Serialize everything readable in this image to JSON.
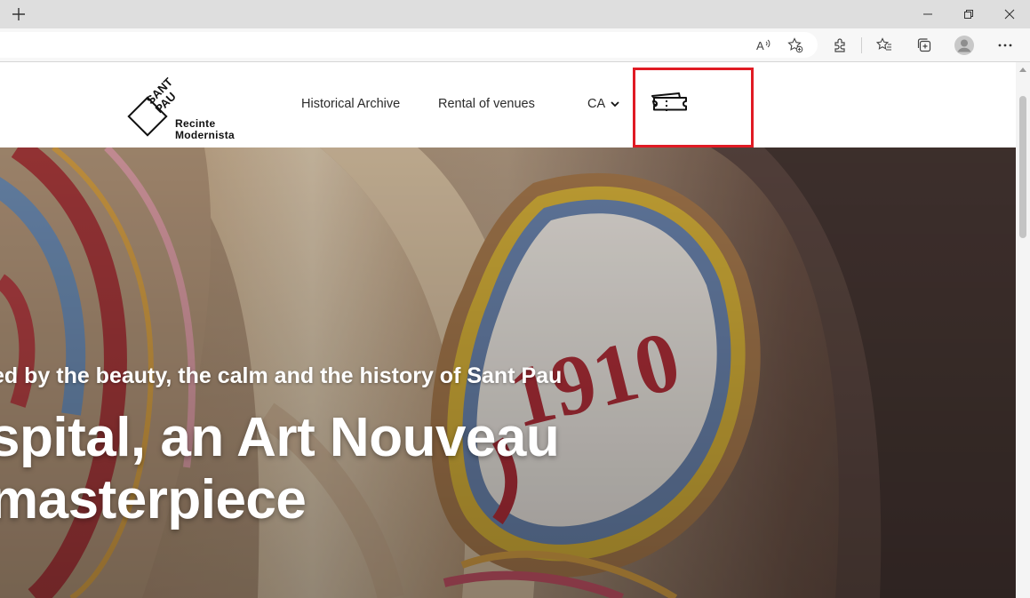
{
  "browser": {
    "new_tab_icon": "plus-icon",
    "window_controls": [
      "minimize-icon",
      "restore-icon",
      "close-icon"
    ],
    "toolbar_icons": [
      "read-aloud-icon",
      "add-favorite-icon",
      "extensions-icon",
      "favorites-icon",
      "collections-icon",
      "profile-icon",
      "more-icon"
    ]
  },
  "site": {
    "logo": {
      "mark_text": "SANT PAU",
      "line1": "Recinte",
      "line2": "Modernista"
    },
    "nav": {
      "historical_archive": "Historical Archive",
      "rental_of_venues": "Rental of venues",
      "language": "CA",
      "tickets_icon": "ticket-icon"
    },
    "hero": {
      "subtitle": "ed by the beauty, the calm and the history of Sant Pau",
      "headline_line1": "spital, an Art Nouveau",
      "headline_line2": "masterpiece",
      "mosaic_year": "1910"
    }
  },
  "colors": {
    "highlight_border": "#e01b24",
    "hero_text": "#ffffff",
    "nav_text": "#2b2b2b"
  }
}
